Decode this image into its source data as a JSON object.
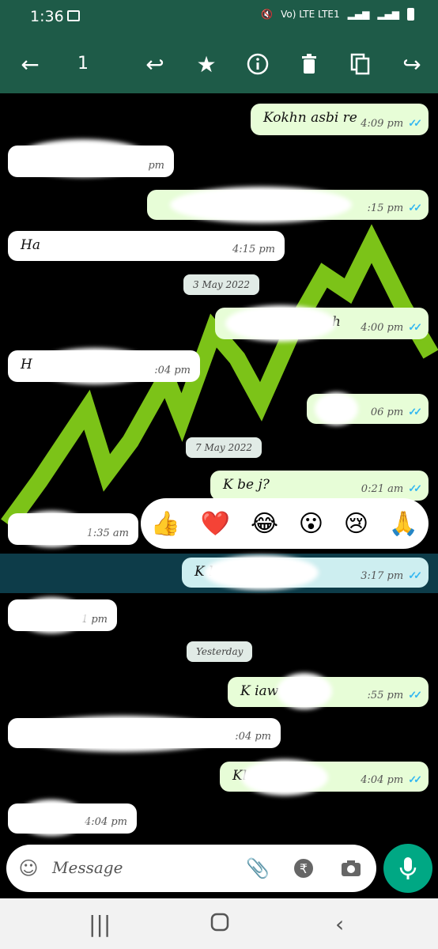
{
  "status": {
    "time": "1:36",
    "network": "Vo) LTE LTE1"
  },
  "toolbar": {
    "selected_count": "1"
  },
  "messages": [
    {
      "dir": "out",
      "text": "Kokhn asbi re",
      "time": "4:09 pm",
      "ticks": "✓✓"
    },
    {
      "dir": "in",
      "text": "",
      "time": "pm"
    },
    {
      "dir": "out",
      "text": "",
      "time": ":15 pm",
      "ticks": "✓✓"
    },
    {
      "dir": "in",
      "text": "Ha",
      "time": "4:15 pm"
    },
    {
      "dir": "out",
      "text": "h",
      "time": "4:00 pm",
      "ticks": "✓✓"
    },
    {
      "dir": "in",
      "text": "H",
      "time": ":04 pm"
    },
    {
      "dir": "out",
      "text": "",
      "time": "06 pm",
      "ticks": "✓✓"
    },
    {
      "dir": "out",
      "text": "K     be     j?",
      "time": "0:21 am",
      "ticks": "✓✓"
    },
    {
      "dir": "in",
      "text": "",
      "time": "1:35 am"
    },
    {
      "dir": "out",
      "text": "K                la h     re",
      "time": "3:17 pm",
      "ticks": "✓✓"
    },
    {
      "dir": "in",
      "text": "",
      "time": "1 pm"
    },
    {
      "dir": "out",
      "text": "K       iaw       ?",
      "time": ":55 pm",
      "ticks": "✓✓"
    },
    {
      "dir": "in",
      "text": "",
      "time": ":04 pm"
    },
    {
      "dir": "out",
      "text": "Kl",
      "time": "4:04 pm",
      "ticks": "✓✓"
    },
    {
      "dir": "in",
      "text": "",
      "time": "4:04 pm"
    }
  ],
  "dates": [
    "3 May 2022",
    "7 May 2022",
    "Yesterday"
  ],
  "reactions": [
    "👍",
    "❤️",
    "😂",
    "😮",
    "😢",
    "🙏"
  ],
  "composer": {
    "placeholder": "Message"
  },
  "colors": {
    "header": "#1e5b48",
    "outgoing": "#e7fdd7",
    "accent": "#00a884",
    "chart": "#7cc318"
  }
}
